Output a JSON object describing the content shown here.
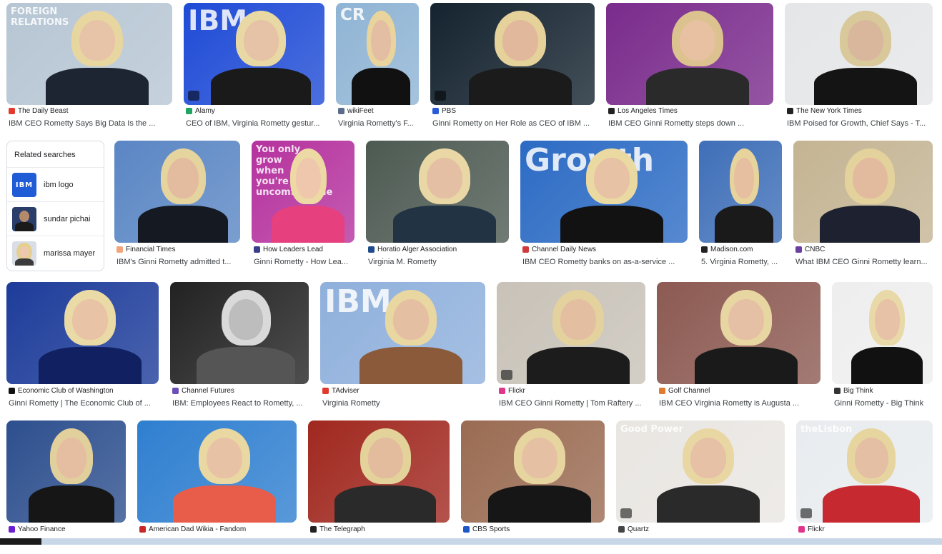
{
  "related": {
    "title": "Related searches",
    "items": [
      {
        "label": "ibm logo",
        "icon": "ibm-logo-icon",
        "thumb_text": "IBM"
      },
      {
        "label": "sundar pichai"
      },
      {
        "label": "marissa mayer"
      }
    ]
  },
  "results": [
    {
      "source": "The Daily Beast",
      "caption": "IBM CEO Rometty Says Big Data Is the ...",
      "fav": "#e23b2e",
      "bg": "#b7c6d4",
      "skin": "#e7c3a8",
      "hair": "#e8d6a0",
      "top": "#1d2533",
      "text": "FOREIGN RELATIONS"
    },
    {
      "source": "Alamy",
      "caption": "CEO of IBM, Virginia Rometty gestur...",
      "fav": "#1fa463",
      "bg": "#1f4bd6",
      "skin": "#e6c2a6",
      "hair": "#e8d9a4",
      "top": "#1a1a1a",
      "text": "IBM"
    },
    {
      "source": "wikiFeet",
      "caption": "Virginia Rometty's F...",
      "fav": "#5b6b8a",
      "bg": "#8fb4d4",
      "skin": "#e4bea2",
      "hair": "#e8d49c",
      "top": "#111111",
      "text": "CR"
    },
    {
      "source": "PBS",
      "caption": "Ginni Rometty on Her Role as CEO of IBM ...",
      "fav": "#2a5bd7",
      "bg": "#14232f",
      "skin": "#e2b89c",
      "hair": "#e5d19a",
      "top": "#1b1b1b",
      "text": ""
    },
    {
      "source": "Los Angeles Times",
      "caption": "IBM CEO Ginni Rometty steps down ...",
      "fav": "#222222",
      "bg": "#7a2b8c",
      "skin": "#e8c0a2",
      "hair": "#dcc28e",
      "top": "#2a2a2a",
      "text": ""
    },
    {
      "source": "The New York Times",
      "caption": "IBM Poised for Growth, Chief Says - T...",
      "fav": "#222222",
      "bg": "#e4e6e8",
      "skin": "#d9b79c",
      "hair": "#d8c89a",
      "top": "#141414",
      "text": ""
    },
    {
      "source": "Financial Times",
      "caption": "IBM's Ginni Rometty admitted t...",
      "fav": "#f2a57c",
      "bg": "#5a86c4",
      "skin": "#e3bca0",
      "hair": "#e6d49e",
      "top": "#151a22",
      "text": ""
    },
    {
      "source": "How Leaders Lead",
      "caption": "Ginni Rometty - How Lea...",
      "fav": "#3a3f8a",
      "bg": "#b5329e",
      "skin": "#eec7ac",
      "hair": "#ecd9a4",
      "top": "#e6407e",
      "text": "You only grow when you're uncomfortable"
    },
    {
      "source": "Horatio Alger Association",
      "caption": "Virginia M. Rometty",
      "fav": "#1e4b8c",
      "bg": "#4d5a52",
      "skin": "#e5bfa3",
      "hair": "#e9d8a6",
      "top": "#223344",
      "text": ""
    },
    {
      "source": "Channel Daily News",
      "caption": "IBM CEO Rometty banks on as-a-service ...",
      "fav": "#d03a3a",
      "bg": "#2c6bc4",
      "skin": "#e8c2a4",
      "hair": "#ebd9a2",
      "top": "#121212",
      "text": "Growth"
    },
    {
      "source": "Madison.com",
      "caption": "5. Virginia Rometty, ...",
      "fav": "#222222",
      "bg": "#3f6fb8",
      "skin": "#e6bea0",
      "hair": "#e7d39c",
      "top": "#1a1a1a",
      "text": ""
    },
    {
      "source": "CNBC",
      "caption": "What IBM CEO Ginni Rometty learn...",
      "fav": "#6b3fa0",
      "bg": "#c4b493",
      "skin": "#e2ba9e",
      "hair": "#e4d29c",
      "top": "#1e2230",
      "text": ""
    },
    {
      "source": "Economic Club of Washington",
      "caption": "Ginni Rometty | The Economic Club of ...",
      "fav": "#111111",
      "bg": "#1d3c9a",
      "skin": "#e9c3a5",
      "hair": "#eadaa6",
      "top": "#102060",
      "text": ""
    },
    {
      "source": "Channel Futures",
      "caption": "IBM: Employees React to Rometty, ...",
      "fav": "#6a4fb8",
      "bg": "#222222",
      "skin": "#bdbdbd",
      "hair": "#d9d9d9",
      "top": "#555555",
      "text": ""
    },
    {
      "source": "TAdviser",
      "caption": "Virginia Rometty",
      "fav": "#e03a2e",
      "bg": "#8fb0dc",
      "skin": "#e5bfa2",
      "hair": "#e9d7a2",
      "top": "#8a5a3a",
      "text": "IBM"
    },
    {
      "source": "Flickr",
      "caption": "IBM CEO Ginni Rometty | Tom Raftery ...",
      "fav": "#e0358a",
      "bg": "#c8c2b8",
      "skin": "#e4bea1",
      "hair": "#e3d29e",
      "top": "#1c1c1c",
      "text": ""
    },
    {
      "source": "Golf Channel",
      "caption": "IBM CEO Virginia Rometty is Augusta ...",
      "fav": "#e07a2e",
      "bg": "#8c5a52",
      "skin": "#e6c0a4",
      "hair": "#e8d6a2",
      "top": "#1a1a1a",
      "text": ""
    },
    {
      "source": "Big Think",
      "caption": "Ginni Rometty - Big Think",
      "fav": "#333333",
      "bg": "#eeeeee",
      "skin": "#e7c2a6",
      "hair": "#e9d9a8",
      "top": "#111111",
      "text": ""
    },
    {
      "source": "Yahoo Finance",
      "caption": "",
      "fav": "#6a1fd0",
      "bg": "#2d4f8e",
      "skin": "#e5bea1",
      "hair": "#e2d09c",
      "top": "#161616",
      "text": ""
    },
    {
      "source": "American Dad Wikia - Fandom",
      "caption": "",
      "fav": "#c62828",
      "bg": "#2f7fd0",
      "skin": "#e8c2a5",
      "hair": "#ead8a2",
      "top": "#e85c4a",
      "text": ""
    },
    {
      "source": "The Telegraph",
      "caption": "",
      "fav": "#222222",
      "bg": "#a0281f",
      "skin": "#e3bb9d",
      "hair": "#e4d29b",
      "top": "#2a2a2a",
      "text": ""
    },
    {
      "source": "CBS Sports",
      "caption": "",
      "fav": "#1f56c8",
      "bg": "#9a6b52",
      "skin": "#e6c0a3",
      "hair": "#e7d5a0",
      "top": "#161616",
      "text": ""
    },
    {
      "source": "Quartz",
      "caption": "",
      "fav": "#444444",
      "bg": "#e9e6e2",
      "skin": "#e7c1a5",
      "hair": "#e9d7a3",
      "top": "#2a2a2a",
      "text": "Good Power"
    },
    {
      "source": "Flickr",
      "caption": "",
      "fav": "#e0358a",
      "bg": "#e8ecef",
      "skin": "#e5bfa3",
      "hair": "#e7d59f",
      "top": "#c62a30",
      "text": "theLisbon"
    }
  ]
}
